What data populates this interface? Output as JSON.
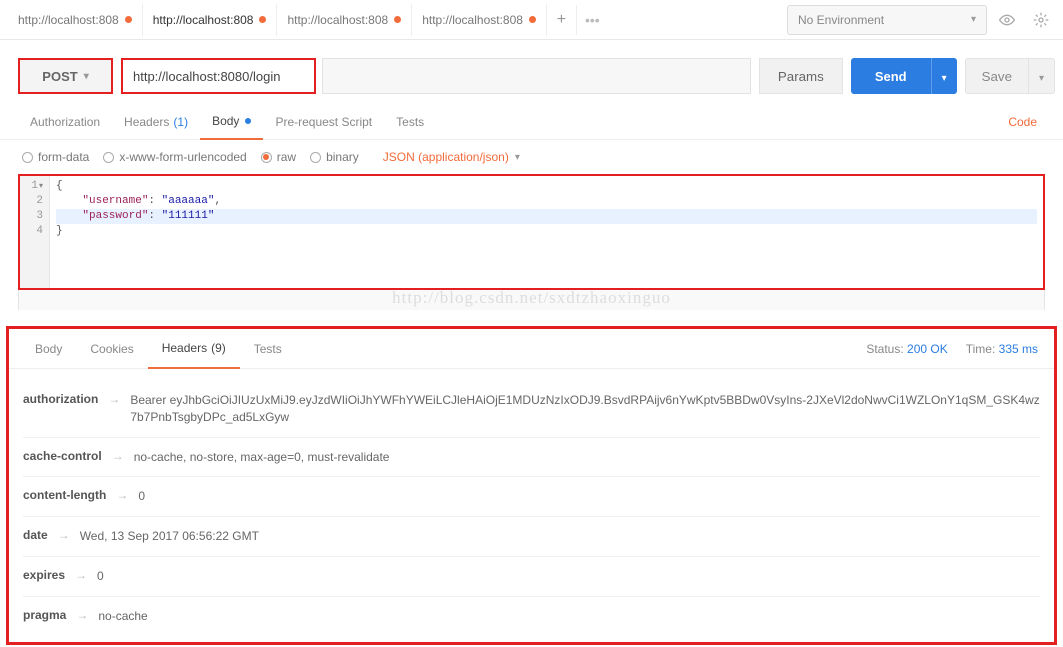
{
  "env": {
    "label": "No Environment"
  },
  "tabs": [
    {
      "label": "http://localhost:808",
      "modified": true,
      "active": false
    },
    {
      "label": "http://localhost:808",
      "modified": true,
      "active": true
    },
    {
      "label": "http://localhost:808",
      "modified": true,
      "active": false
    },
    {
      "label": "http://localhost:808",
      "modified": true,
      "active": false
    }
  ],
  "request": {
    "method": "POST",
    "url": "http://localhost:8080/login",
    "params_label": "Params",
    "send_label": "Send",
    "save_label": "Save"
  },
  "sub_tabs": {
    "authorization": "Authorization",
    "headers": "Headers",
    "headers_count": "(1)",
    "body": "Body",
    "pre": "Pre-request Script",
    "tests": "Tests",
    "code": "Code"
  },
  "body_opts": {
    "form": "form-data",
    "url": "x-www-form-urlencoded",
    "raw": "raw",
    "binary": "binary",
    "content_type": "JSON (application/json)"
  },
  "editor": {
    "l1": "{",
    "l2a": "    \"username\"",
    "l2b": ": ",
    "l2c": "\"aaaaaa\"",
    "l2d": ",",
    "l3a": "    \"password\"",
    "l3b": ": ",
    "l3c": "\"111111\"",
    "l4": "}"
  },
  "watermark": "http://blog.csdn.net/sxdtzhaoxinguo",
  "response": {
    "tabs": {
      "body": "Body",
      "cookies": "Cookies",
      "headers": "Headers",
      "headers_count": "(9)",
      "tests": "Tests"
    },
    "status_label": "Status:",
    "status_value": "200 OK",
    "time_label": "Time:",
    "time_value": "335 ms",
    "headers": [
      {
        "name": "authorization",
        "value": "Bearer eyJhbGciOiJIUzUxMiJ9.eyJzdWIiOiJhYWFhYWEiLCJleHAiOjE1MDUzNzIxODJ9.BsvdRPAijv6nYwKptv5BBDw0VsyIns-2JXeVl2doNwvCi1WZLOnY1qSM_GSK4wz7b7PnbTsgbyDPc_ad5LxGyw"
      },
      {
        "name": "cache-control",
        "value": "no-cache, no-store, max-age=0, must-revalidate"
      },
      {
        "name": "content-length",
        "value": "0"
      },
      {
        "name": "date",
        "value": "Wed, 13 Sep 2017 06:56:22 GMT"
      },
      {
        "name": "expires",
        "value": "0"
      },
      {
        "name": "pragma",
        "value": "no-cache"
      }
    ]
  }
}
